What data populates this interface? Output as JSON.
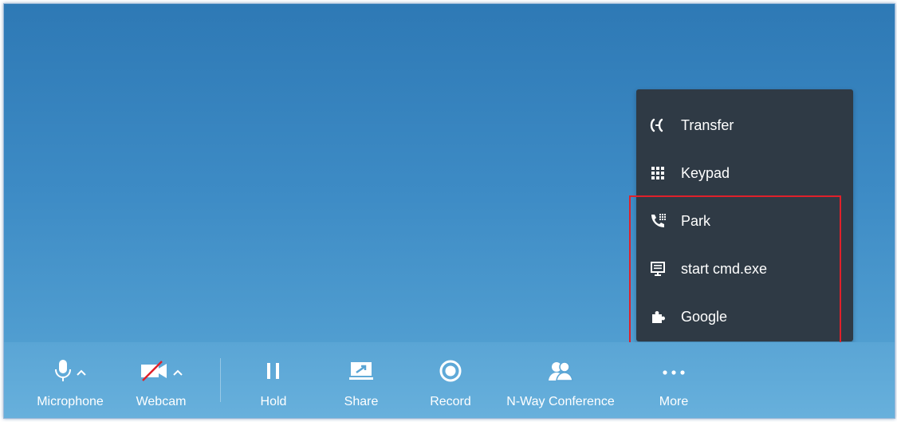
{
  "menu": {
    "items": [
      {
        "label": "Transfer",
        "icon": "transfer-icon"
      },
      {
        "label": "Keypad",
        "icon": "keypad-icon"
      },
      {
        "label": "Park",
        "icon": "park-icon"
      },
      {
        "label": "start cmd.exe",
        "icon": "monitor-icon"
      },
      {
        "label": "Google",
        "icon": "puzzle-icon"
      }
    ]
  },
  "toolbar": {
    "microphone": "Microphone",
    "webcam": "Webcam",
    "hold": "Hold",
    "share": "Share",
    "record": "Record",
    "conference": "N-Way Conference",
    "more": "More"
  },
  "colors": {
    "menu_bg": "#2f3a45",
    "highlight": "#e0202a",
    "toolbar_bg": "#5aa5d5",
    "stage_top": "#2e79b5"
  }
}
